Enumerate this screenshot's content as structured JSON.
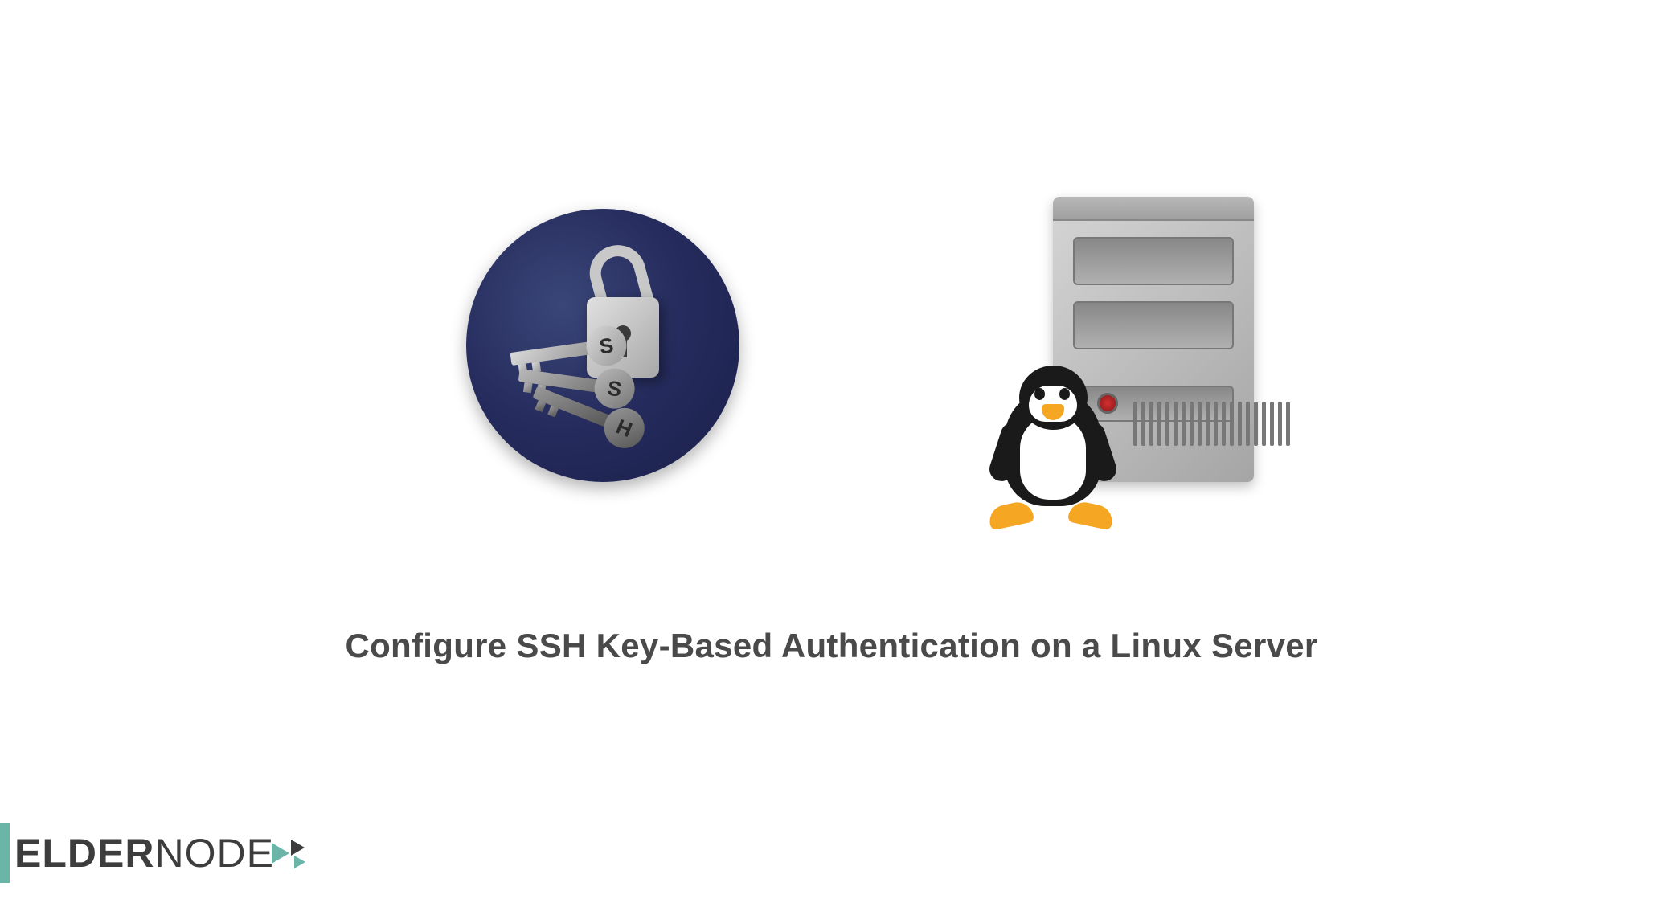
{
  "title": "Configure SSH Key-Based Authentication on a Linux Server",
  "logo": {
    "brand_part1": "ELDER",
    "brand_part2": "NODE"
  },
  "ssh_keys": {
    "key1_label": "S",
    "key2_label": "S",
    "key3_label": "H"
  },
  "icons": {
    "ssh_badge": "ssh-keys-padlock-icon",
    "server": "linux-server-icon",
    "penguin": "tux-penguin-icon"
  },
  "colors": {
    "title_text": "#4a4a4a",
    "logo_accent": "#6bb5a8",
    "logo_text": "#3d3d3d",
    "ssh_circle_bg": "#252b5c",
    "server_body": "#b0b0b0",
    "server_led": "#c02020",
    "penguin_accent": "#f5a623"
  }
}
